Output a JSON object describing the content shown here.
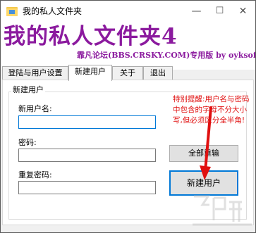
{
  "window": {
    "title": "我的私人文件夹",
    "app_icon": "folder-icon"
  },
  "controls": {
    "minimize": "—",
    "maximize": "☐",
    "close": "✕"
  },
  "banner": {
    "title": "我的私人文件夹4",
    "subtitle": "霏凡论坛(BBS.CRSKY.COM)专用版 by oyksoft",
    "color": "#8b1a9e"
  },
  "tabs": [
    {
      "label": "登陆与用户设置"
    },
    {
      "label": "新建用户",
      "active": true
    },
    {
      "label": "关于"
    },
    {
      "label": "退出"
    }
  ],
  "new_user": {
    "group_title": "新建用户",
    "username_label": "新用户名:",
    "username_value": "",
    "password_label": "密码:",
    "password_value": "",
    "confirm_label": "重复密码:",
    "confirm_value": "",
    "reset_button": "全部重输",
    "create_button": "新建用户"
  },
  "annotation": {
    "text": "特别提醒:用户名与密码中包含的字母不分大小写,但必须区分全半角!",
    "color": "#e01010"
  }
}
